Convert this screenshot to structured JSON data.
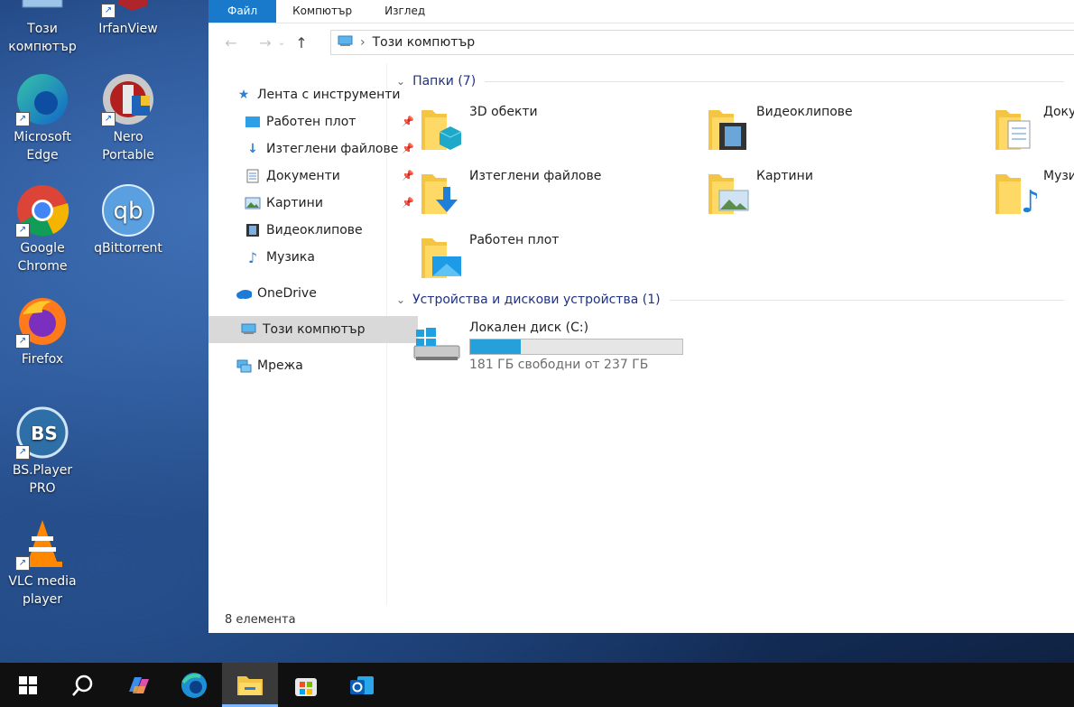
{
  "desktop": {
    "icons": [
      {
        "label": "Този\nкомпютър",
        "name": "this-pc"
      },
      {
        "label": "IrfanView",
        "name": "irfanview"
      },
      {
        "label": "Microsoft\nEdge",
        "name": "microsoft-edge"
      },
      {
        "label": "Nero\nPortable",
        "name": "nero-portable"
      },
      {
        "label": "Google\nChrome",
        "name": "google-chrome"
      },
      {
        "label": "qBittorrent",
        "name": "qbittorrent"
      },
      {
        "label": "Firefox",
        "name": "firefox"
      },
      {
        "label": "BS.Player\nPRO",
        "name": "bsplayer-pro"
      },
      {
        "label": "VLC media\nplayer",
        "name": "vlc-media-player"
      }
    ],
    "icon_glyphs": {
      "qbittorrent": "qb",
      "bsplayer": "BS"
    }
  },
  "explorer": {
    "ribbon_tabs": [
      "Файл",
      "Компютър",
      "Изглед"
    ],
    "address": "Този компютър",
    "sidebar": {
      "quick_access": "Лента с инструменти",
      "items": [
        "Работен плот",
        "Изтеглени файлове",
        "Документи",
        "Картини",
        "Видеоклипове",
        "Музика"
      ],
      "onedrive": "OneDrive",
      "this_pc": "Този компютър",
      "network": "Мрежа"
    },
    "groups": {
      "folders": "Папки (7)",
      "devices": "Устройства и дискови устройства (1)"
    },
    "folders": [
      "3D обекти",
      "Видеоклипове",
      "Документи",
      "Изтеглени файлове",
      "Картини",
      "Музика",
      "Работен плот"
    ],
    "drive": {
      "name": "Локален диск (C:)",
      "free_text": "181 ГБ свободни от 237 ГБ",
      "used_fraction": 0.24
    },
    "status": "8 елемента"
  },
  "colors": {
    "accent": "#1979ca",
    "folder": "#f4c542",
    "drive_bar": "#26a0da"
  }
}
